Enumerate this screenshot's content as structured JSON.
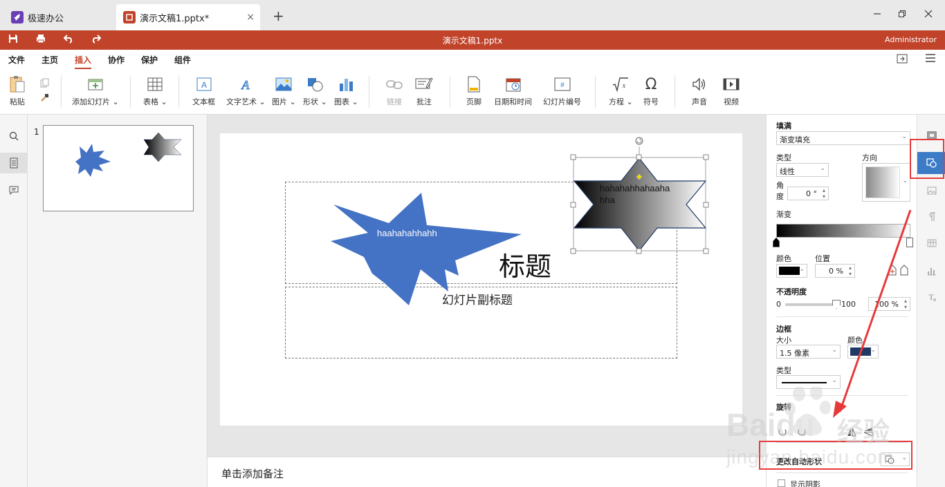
{
  "tabs": {
    "home_label": "极速办公",
    "doc_label": "演示文稿1.pptx*",
    "close_glyph": "×",
    "new_glyph": "+"
  },
  "window": {
    "title": "演示文稿1.pptx",
    "user": "Administrator"
  },
  "menus": [
    "文件",
    "主页",
    "插入",
    "协作",
    "保护",
    "组件"
  ],
  "menu_active_index": 2,
  "ribbon": {
    "paste": "粘贴",
    "add_slide": "添加幻灯片",
    "table": "表格",
    "textbox": "文本框",
    "wordart": "文字艺术",
    "picture": "图片",
    "shape": "形状",
    "chart": "图表",
    "link": "链接",
    "comment": "批注",
    "footer": "页脚",
    "datetime": "日期和时间",
    "slide_number": "幻灯片编号",
    "equation": "方程",
    "symbol": "符号",
    "audio": "声音",
    "video": "视频"
  },
  "thumbnail": {
    "number": "1"
  },
  "slide": {
    "title_placeholder": "标题",
    "subtitle_placeholder": "幻灯片副标题",
    "star_text": "haahahahhahh",
    "hexagram_text_line1": "hahahahhahaaha",
    "hexagram_text_line2": "hha"
  },
  "notes_placeholder": "单击添加备注",
  "properties": {
    "fill_label": "填满",
    "fill_value": "渐变填充",
    "type_label": "类型",
    "type_value": "线性",
    "direction_label": "方向",
    "angle_label_1": "角",
    "angle_label_2": "度",
    "angle_value": "0 °",
    "gradient_label": "渐变",
    "color_label": "颜色",
    "position_label": "位置",
    "position_value": "0 %",
    "opacity_label": "不透明度",
    "opacity_min": "0",
    "opacity_max": "100",
    "opacity_value": "100 %",
    "border_label": "边框",
    "size_label": "大小",
    "size_value": "1.5 像素",
    "border_color_label": "颜色",
    "border_type_label": "类型",
    "rotate_label": "旋转",
    "change_shape_label": "更改自动形状",
    "show_shadow_label": "显示阴影"
  },
  "colors": {
    "accent": "#c1432a",
    "star_blue": "#4472c4",
    "border_navy": "#1f3864",
    "annotation_red": "#e63a3a",
    "tool_active": "#3c7bc6"
  },
  "watermark": {
    "brand": "Baidu",
    "brand_cn": "经验",
    "url": "jingyan.baidu.com"
  }
}
